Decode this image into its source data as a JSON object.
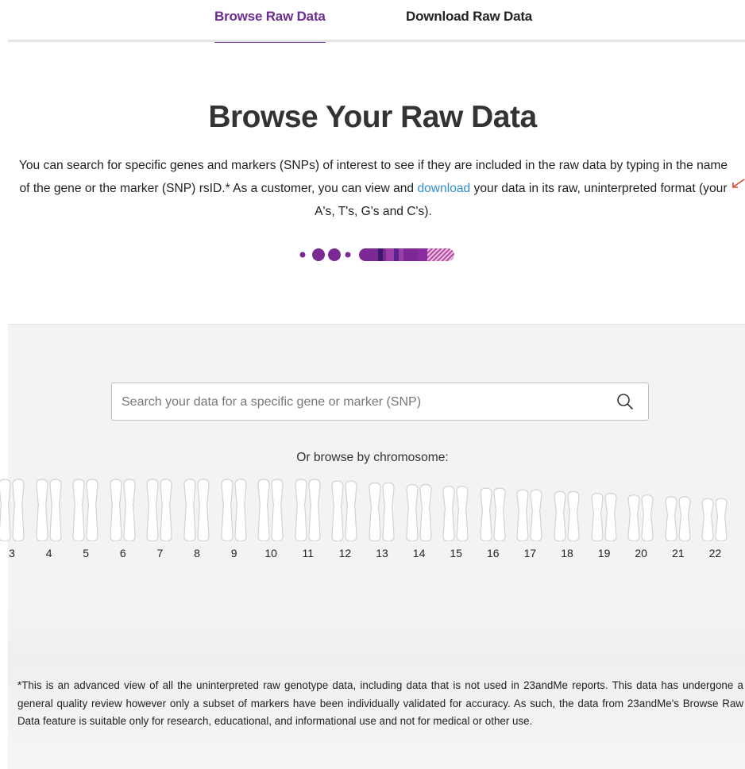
{
  "tabs": {
    "browse": "Browse Raw Data",
    "download": "Download Raw Data"
  },
  "heading": "Browse Your Raw Data",
  "intro": {
    "text_before": "You can search for specific genes and markers (SNPs) of interest to see if they are included in the raw data by typing in the name of the gene or the marker (SNP) rsID.* As a customer, you can view and ",
    "link": "download",
    "text_after": " your data in its raw, uninterpreted format (your A's, T's, G's and C's)."
  },
  "search": {
    "placeholder": "Search your data for a specific gene or marker (SNP)",
    "value": ""
  },
  "browse_label": "Or browse by chromosome:",
  "chromosomes": [
    "3",
    "4",
    "5",
    "6",
    "7",
    "8",
    "9",
    "10",
    "11",
    "12",
    "13",
    "14",
    "15",
    "16",
    "17",
    "18",
    "19",
    "20",
    "21",
    "22"
  ],
  "disclaimer": "*This is an advanced view of all the uninterpreted raw genotype data, including data that is not used in 23andMe reports. This data has undergone a general quality review however only a subset of markers have been individually validated for accuracy. As such, the data from 23andMe's Browse Raw Data feature is suitable only for research, educational, and informational use and not for medical or other use.",
  "colors": {
    "accent": "#6b2d8f",
    "link": "#2f8fcf",
    "grey_bg": "#f3f3f3"
  },
  "icons": {
    "search": "search-icon",
    "arrow": "red-arrow-icon"
  }
}
